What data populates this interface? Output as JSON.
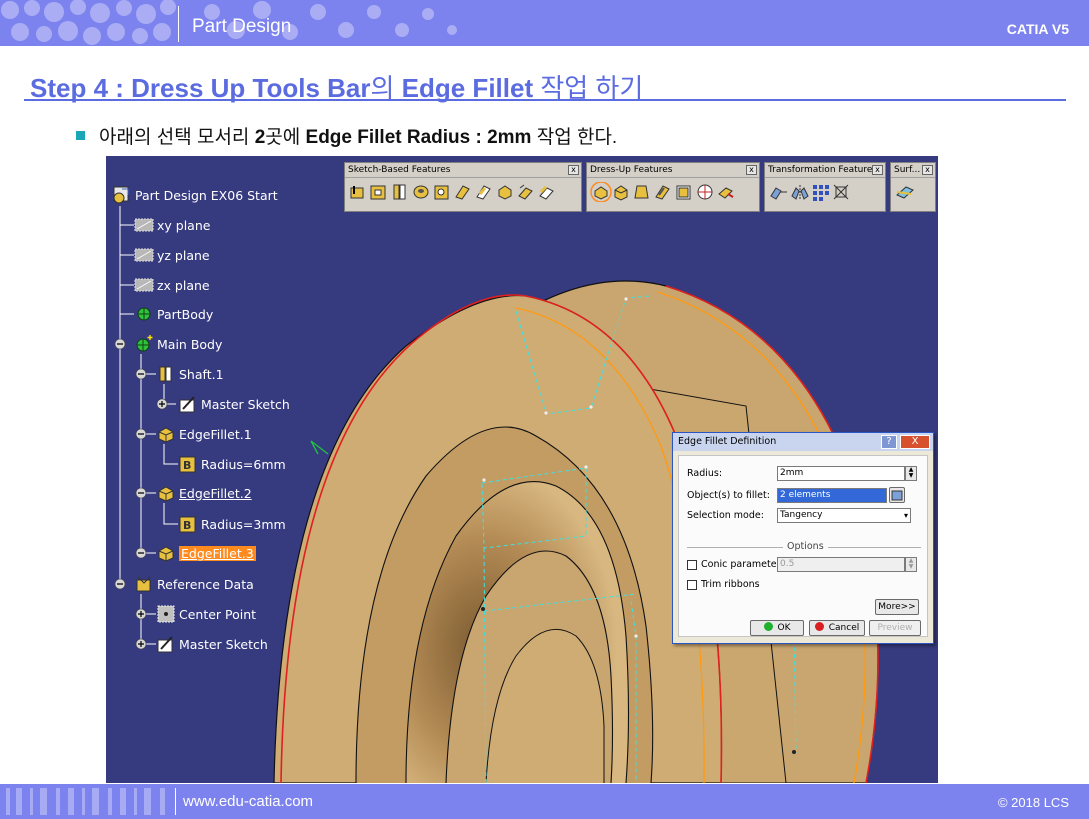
{
  "header": {
    "title": "Part Design",
    "brand": "CATIA V5"
  },
  "step": {
    "prefix": "Step 4 : Dress Up Tools Bar",
    "particle": "의",
    "bold_mid": " Edge Fillet",
    "suffix": " 작업 하기"
  },
  "bullet": {
    "p1": "아래의 선택 모서리 ",
    "b1": "2",
    "p2": "곳에 ",
    "b2": "Edge Fillet Radius : 2mm",
    "p3": " 작업 한다."
  },
  "tree": {
    "items": [
      {
        "label": "Part Design EX06 Start",
        "icon": "part-icon"
      },
      {
        "label": "xy plane",
        "icon": "plane-icon"
      },
      {
        "label": "yz plane",
        "icon": "plane-icon"
      },
      {
        "label": "zx plane",
        "icon": "plane-icon"
      },
      {
        "label": "PartBody",
        "icon": "body-icon"
      },
      {
        "label": "Main Body",
        "icon": "body-icon"
      },
      {
        "label": "Shaft.1",
        "icon": "shaft-icon"
      },
      {
        "label": "Master Sketch",
        "icon": "sketch-icon"
      },
      {
        "label": "EdgeFillet.1",
        "icon": "fillet-icon"
      },
      {
        "label": "Radius=6mm",
        "icon": "parameter-icon"
      },
      {
        "label": "EdgeFillet.2",
        "icon": "fillet-icon"
      },
      {
        "label": "Radius=3mm",
        "icon": "parameter-icon"
      },
      {
        "label": "EdgeFillet.3",
        "icon": "fillet-icon"
      },
      {
        "label": "Reference Data",
        "icon": "geometrical-set-icon"
      },
      {
        "label": "Center Point",
        "icon": "point-icon"
      },
      {
        "label": "Master Sketch",
        "icon": "sketch-icon"
      }
    ]
  },
  "toolbars": {
    "sketch_based": {
      "title": "Sketch-Based Features"
    },
    "dress_up": {
      "title": "Dress-Up Features"
    },
    "transformation": {
      "title": "Transformation Features"
    },
    "surface": {
      "title": "Surf..."
    }
  },
  "dialog": {
    "title": "Edge Fillet Definition",
    "help": "?",
    "close": "X",
    "radius_label": "Radius:",
    "radius_value": "2mm",
    "objects_label": "Object(s) to fillet:",
    "objects_value": "2 elements",
    "selection_mode_label": "Selection mode:",
    "selection_mode_value": "Tangency",
    "options_label": "Options",
    "conic_label": "Conic parameter:",
    "conic_value": "0.5",
    "trim_label": "Trim ribbons",
    "more_label": "More>>",
    "ok_label": "OK",
    "cancel_label": "Cancel",
    "preview_label": "Preview"
  },
  "footer": {
    "url": "www.edu-catia.com",
    "copyright": "© 2018 LCS"
  },
  "colors": {
    "band": "#7d83ee",
    "title": "#5b6be0",
    "bullet": "#19a6b6",
    "viewport": "#363a7f",
    "part": "#c9a56f",
    "selection": "#ff8a1e"
  }
}
